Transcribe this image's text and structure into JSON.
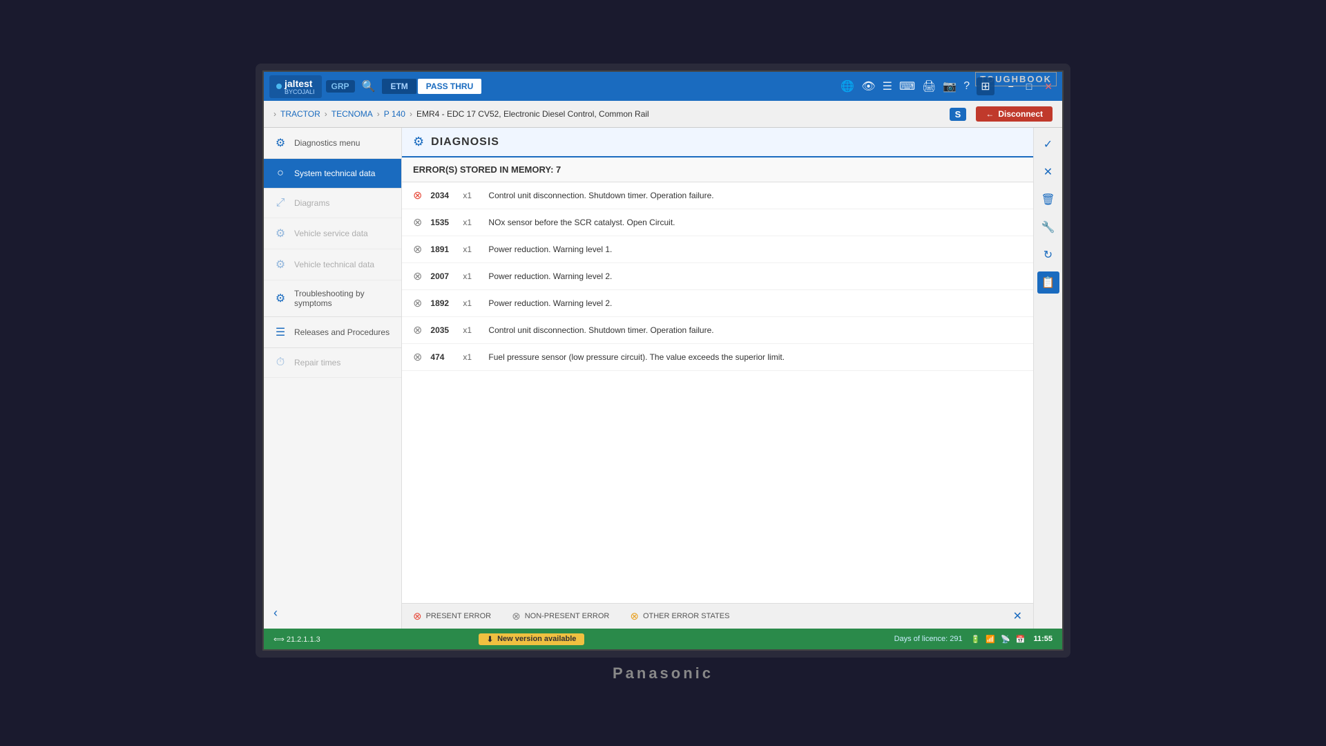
{
  "toughbook": {
    "label": "TOUGHBOOK"
  },
  "titlebar": {
    "logo": "jaltest",
    "logo_sub": "BYCOJALI",
    "grp": "GRP",
    "etm": "ETM",
    "pass_thru": "PASS\nTHRU",
    "tabs": [
      "ETM",
      "PASS THRU"
    ]
  },
  "breadcrumb": {
    "items": [
      "TRACTOR",
      "TECNOMA",
      "P 140"
    ],
    "current": "EMR4 - EDC 17 CV52, Electronic Diesel Control, Common Rail",
    "s_badge": "S",
    "disconnect": "Disconnect"
  },
  "sidebar": {
    "items": [
      {
        "id": "diagnostics-menu",
        "label": "Diagnostics menu",
        "icon": "⚙",
        "active": false,
        "disabled": false
      },
      {
        "id": "system-technical-data",
        "label": "System technical data",
        "icon": "○",
        "active": true,
        "disabled": false
      },
      {
        "id": "diagrams",
        "label": "Diagrams",
        "icon": "⤢",
        "active": false,
        "disabled": true
      },
      {
        "id": "vehicle-service-data",
        "label": "Vehicle service data",
        "icon": "⚙",
        "active": false,
        "disabled": true
      },
      {
        "id": "vehicle-technical-data",
        "label": "Vehicle technical data",
        "icon": "⚙",
        "active": false,
        "disabled": true
      },
      {
        "id": "troubleshooting",
        "label": "Troubleshooting by symptoms",
        "icon": "⚙",
        "active": false,
        "disabled": false
      },
      {
        "id": "releases-procedures",
        "label": "Releases and Procedures",
        "icon": "☰",
        "active": false,
        "disabled": false
      },
      {
        "id": "repair-times",
        "label": "Repair times",
        "icon": "⏱",
        "active": false,
        "disabled": true
      }
    ]
  },
  "diagnosis": {
    "title": "DIAGNOSIS",
    "errors_summary": "ERROR(S) STORED IN MEMORY: 7",
    "errors": [
      {
        "code": "2034",
        "count": "x1",
        "desc": "Control unit disconnection. Shutdown timer. Operation failure.",
        "type": "present"
      },
      {
        "code": "1535",
        "count": "x1",
        "desc": "NOx sensor before the SCR catalyst. Open Circuit.",
        "type": "nonprosent"
      },
      {
        "code": "1891",
        "count": "x1",
        "desc": "Power reduction. Warning level 1.",
        "type": "nonprosent"
      },
      {
        "code": "2007",
        "count": "x1",
        "desc": "Power reduction. Warning level 2.",
        "type": "nonprosent"
      },
      {
        "code": "1892",
        "count": "x1",
        "desc": "Power reduction. Warning level 2.",
        "type": "nonprosent"
      },
      {
        "code": "2035",
        "count": "x1",
        "desc": "Control unit disconnection. Shutdown timer. Operation failure.",
        "type": "nonprosent"
      },
      {
        "code": "474",
        "count": "x1",
        "desc": "Fuel pressure sensor (low pressure circuit). The value exceeds the superior limit.",
        "type": "nonprosent"
      }
    ],
    "legend": [
      {
        "id": "present-error",
        "label": "PRESENT ERROR",
        "type": "red"
      },
      {
        "id": "non-present-error",
        "label": "NON-PRESENT ERROR",
        "type": "gray"
      },
      {
        "id": "other-error-states",
        "label": "OTHER ERROR STATES",
        "type": "gray-x"
      }
    ]
  },
  "right_bar": {
    "buttons": [
      {
        "id": "check",
        "icon": "✓"
      },
      {
        "id": "close",
        "icon": "✕"
      },
      {
        "id": "delete",
        "icon": "🗑"
      },
      {
        "id": "wrench",
        "icon": "🔧"
      },
      {
        "id": "refresh",
        "icon": "↻"
      },
      {
        "id": "clipboard",
        "icon": "📋"
      }
    ]
  },
  "statusbar": {
    "version": "21.2.1.1.3",
    "update": "New version available",
    "licence": "Days of licence: 291",
    "time": "11:55"
  },
  "panasonic": {
    "label": "Panasonic"
  }
}
